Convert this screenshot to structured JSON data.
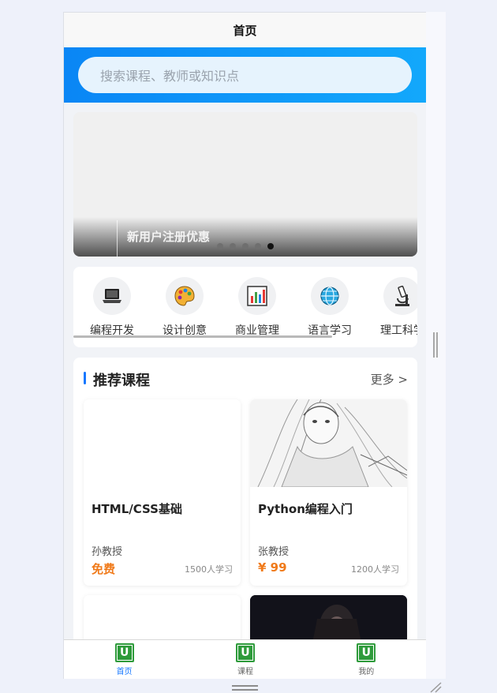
{
  "header": {
    "title": "首页"
  },
  "search": {
    "placeholder": "搜索课程、教师或知识点"
  },
  "banner": {
    "title": "新用户注册优惠",
    "dots": 5,
    "active_dot": 4
  },
  "categories": [
    {
      "label": "编程开发",
      "icon": "laptop-icon"
    },
    {
      "label": "设计创意",
      "icon": "palette-icon"
    },
    {
      "label": "商业管理",
      "icon": "bar-chart-icon"
    },
    {
      "label": "语言学习",
      "icon": "globe-icon"
    },
    {
      "label": "理工科学",
      "icon": "microscope-icon"
    }
  ],
  "recommend": {
    "title": "推荐课程",
    "more": "更多 >",
    "courses": [
      {
        "name": "HTML/CSS基础",
        "teacher": "孙教授",
        "price": "免费",
        "learners": "1500人学习"
      },
      {
        "name": "Python编程入门",
        "teacher": "张教授",
        "price": "¥ 99",
        "learners": "1200人学习"
      }
    ]
  },
  "tabbar": [
    {
      "label": "首页",
      "active": true
    },
    {
      "label": "课程",
      "active": false
    },
    {
      "label": "我的",
      "active": false
    }
  ],
  "colors": {
    "accent": "#1677ff",
    "price": "#f07a1a",
    "search_gradient_start": "#0a86f5",
    "search_gradient_end": "#13a8fb"
  }
}
